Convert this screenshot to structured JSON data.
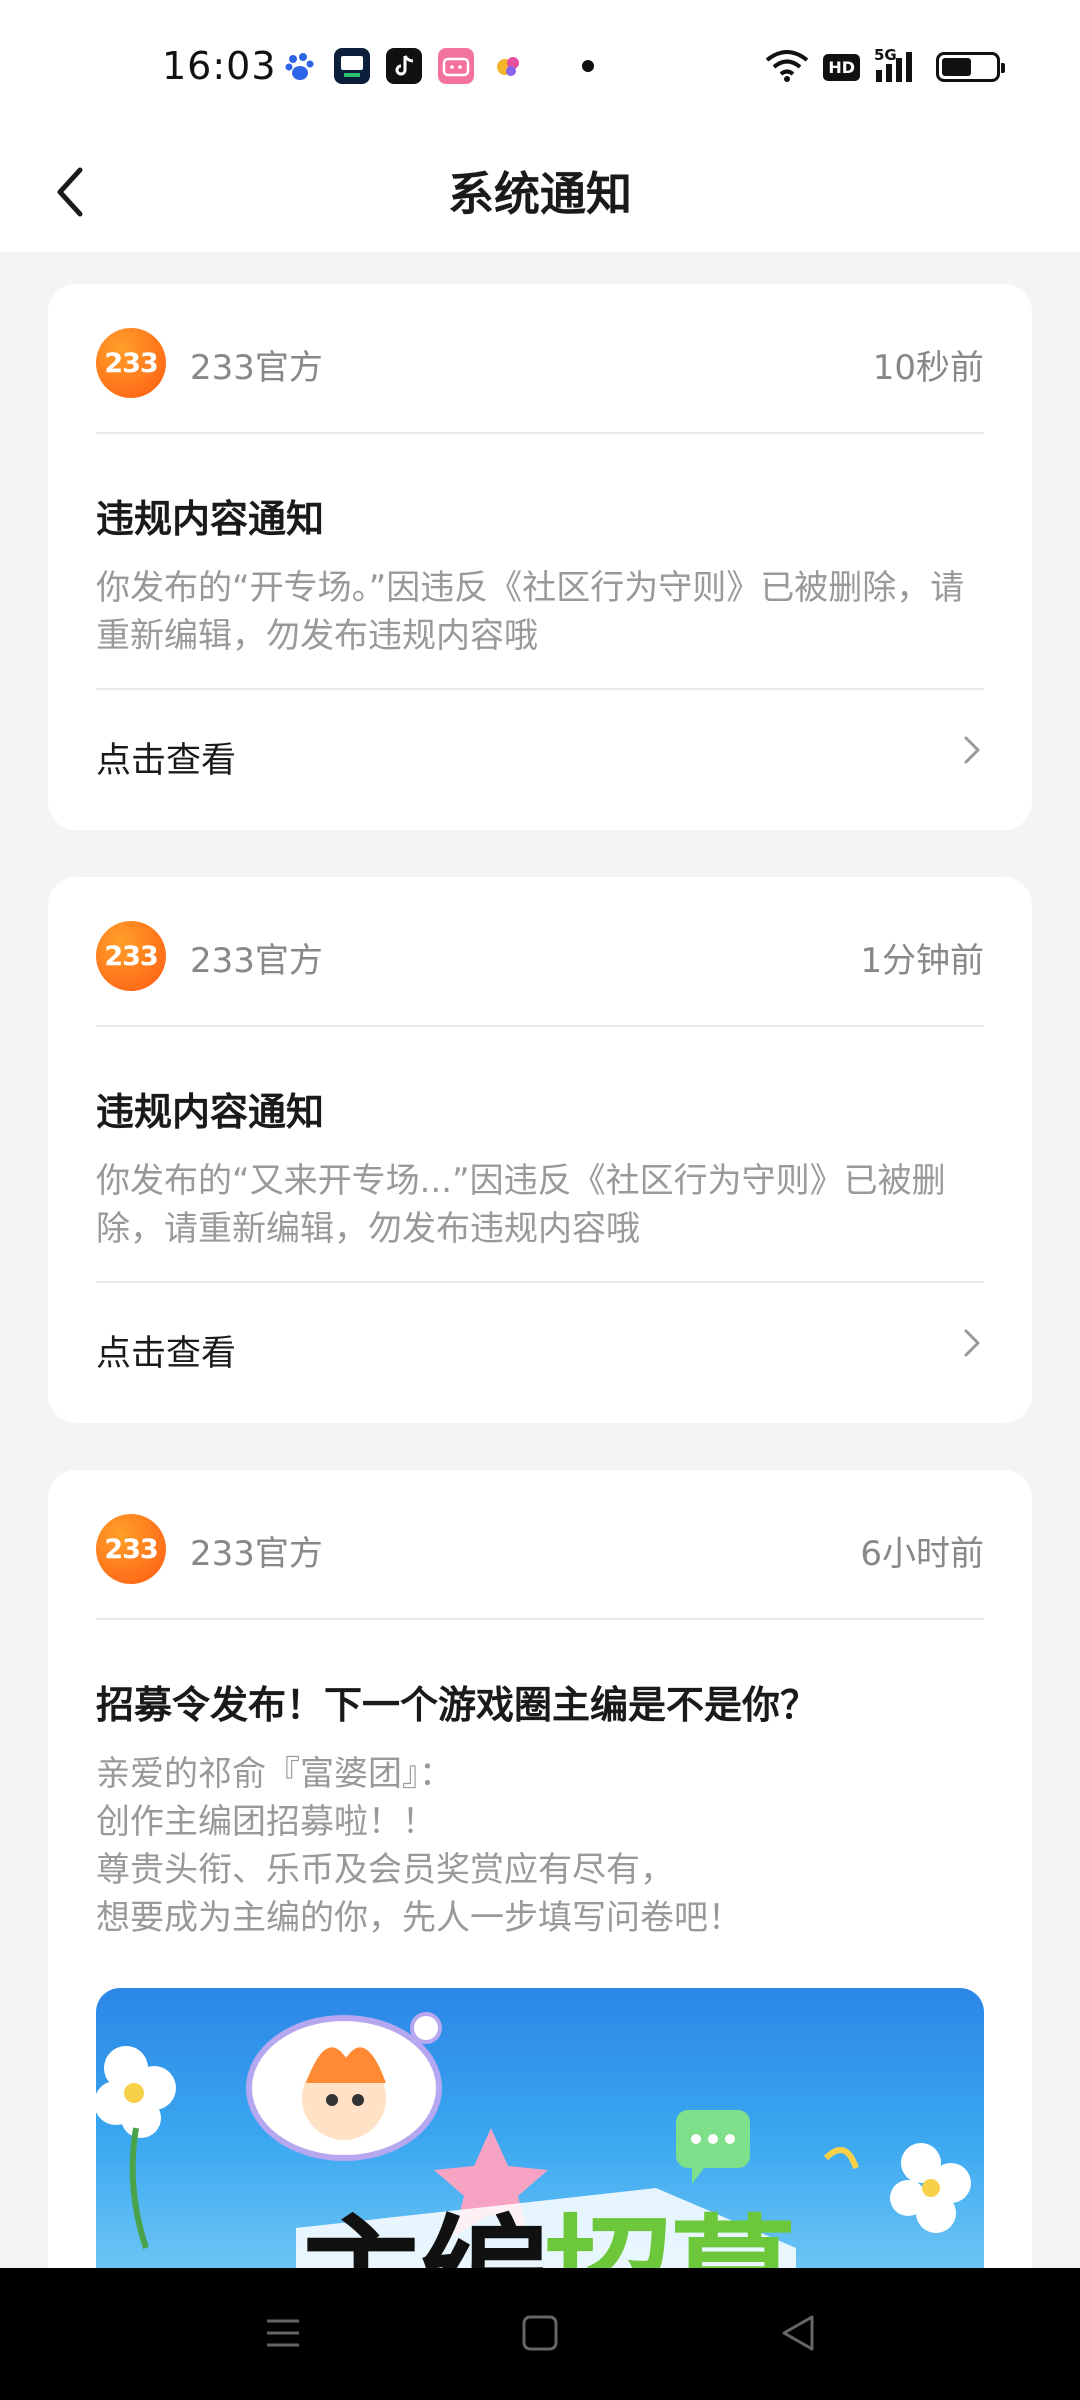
{
  "status_bar": {
    "time": "16:03",
    "apps": [
      {
        "icon": "baidu-icon",
        "color": "#ffffff"
      },
      {
        "icon": "news-app-icon",
        "color": "#0b1f3a"
      },
      {
        "icon": "tiktok-icon",
        "color": "#111111"
      },
      {
        "icon": "bilibili-icon",
        "color": "#f472a0"
      },
      {
        "icon": "taobao-icon",
        "color": "#ffffff"
      }
    ],
    "hd_badge": "HD",
    "network": "5G",
    "battery_level": 0.55
  },
  "nav": {
    "title": "系统通知"
  },
  "notifications": [
    {
      "avatar_text": "233",
      "sender": "233官方",
      "time": "10秒前",
      "title": "违规内容通知",
      "body": "你发布的“开专场。”因违反《社区行为守则》已被删除，请重新编辑，勿发布违规内容哦",
      "action_label": "点击查看"
    },
    {
      "avatar_text": "233",
      "sender": "233官方",
      "time": "1分钟前",
      "title": "违规内容通知",
      "body": "你发布的“又来开专场...”因违反《社区行为守则》已被删除，请重新编辑，勿发布违规内容哦",
      "action_label": "点击查看"
    },
    {
      "avatar_text": "233",
      "sender": "233官方",
      "time": "6小时前",
      "title": "招募令发布！下一个游戏圈主编是不是你？",
      "body_lines": [
        "亲爱的祁俞『富婆团』：",
        "创作主编团招募啦！！",
        "尊贵头衔、乐币及会员奖赏应有尽有，",
        "想要成为主编的你，先人一步填写问卷吧！"
      ],
      "banner_text_dark_1": "主编",
      "banner_text_green": "招募",
      "banner_text_dark_2": ""
    }
  ],
  "colors": {
    "accent_orange": "#ff6a13",
    "page_bg": "#f4f4f4",
    "muted_text": "#999999"
  }
}
